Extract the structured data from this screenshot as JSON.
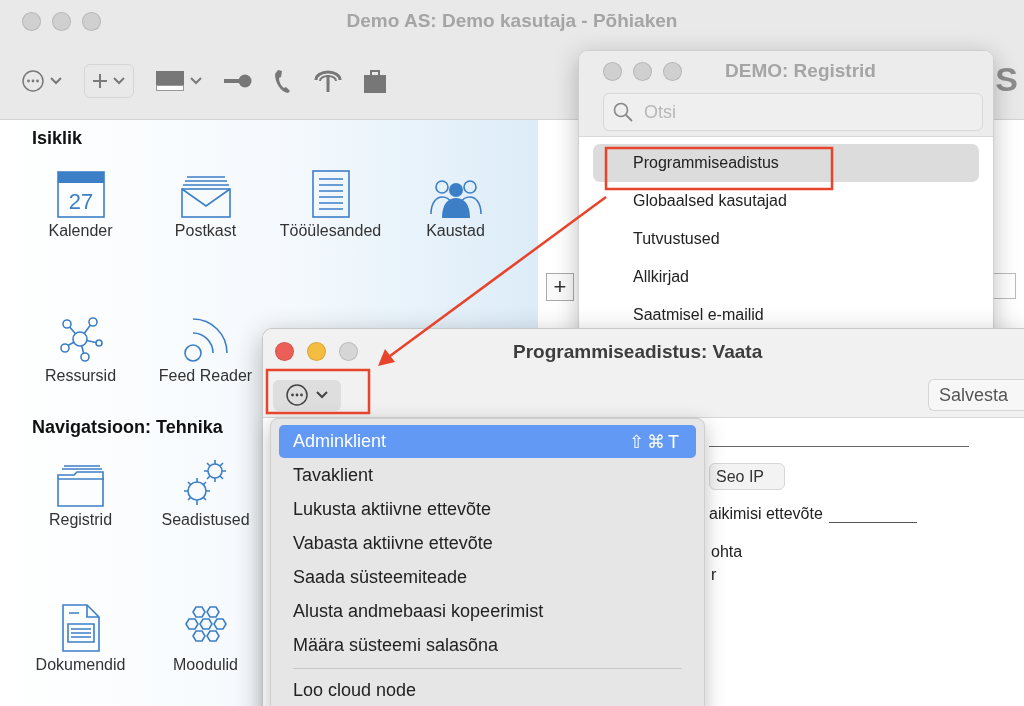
{
  "main_window": {
    "title": "Demo AS: Demo kasutaja - Põhiaken",
    "toolbar": [
      {
        "kind": "more"
      },
      {
        "kind": "add"
      },
      {
        "kind": "color"
      },
      {
        "kind": "key"
      },
      {
        "kind": "phone"
      },
      {
        "kind": "antenna"
      },
      {
        "kind": "bag"
      }
    ],
    "logo_fragment": "S",
    "sections": [
      {
        "heading": "Isiklik",
        "items": [
          {
            "label": "Kalender",
            "kind": "calendar",
            "date": "27"
          },
          {
            "label": "Postkast",
            "kind": "mail"
          },
          {
            "label": "Tööülesanded",
            "kind": "list"
          },
          {
            "label": "Kaustad",
            "kind": "people"
          },
          {
            "label": "Ressursid",
            "kind": "network"
          },
          {
            "label": "Feed Reader",
            "kind": "feed"
          }
        ]
      },
      {
        "heading": "Navigatsioon: Tehnika",
        "items": [
          {
            "label": "Registrid",
            "kind": "folder"
          },
          {
            "label": "Seadistused",
            "kind": "gears"
          },
          {
            "label": "Dokumendid",
            "kind": "document"
          },
          {
            "label": "Moodulid",
            "kind": "hexagons"
          }
        ]
      }
    ],
    "add_button": "+"
  },
  "registers_window": {
    "title": "DEMO: Registrid",
    "search": {
      "placeholder": "Otsi"
    },
    "items": [
      {
        "label": "Programmiseadistus",
        "selected": true
      },
      {
        "label": "Globaalsed kasutajad",
        "selected": false
      },
      {
        "label": "Tutvustused",
        "selected": false
      },
      {
        "label": "Allkirjad",
        "selected": false
      },
      {
        "label": "Saatmisel e-mailid",
        "selected": false
      }
    ]
  },
  "detail_window": {
    "title": "Programmiseadistus: Vaata",
    "save_button": "Salvesta",
    "ip_button": "Seo IP",
    "field_label": "aikimisi ettevõte",
    "text_fragments": [
      "ohta",
      "r"
    ]
  },
  "menu": {
    "items": [
      {
        "kind": "item",
        "label": "Adminklient",
        "shortcut": "⇧⌘T",
        "selected": true
      },
      {
        "kind": "item",
        "label": "Tavaklient",
        "selected": false
      },
      {
        "kind": "item",
        "label": "Lukusta aktiivne ettevõte",
        "selected": false
      },
      {
        "kind": "item",
        "label": "Vabasta aktiivne ettevõte",
        "selected": false
      },
      {
        "kind": "item",
        "label": "Saada süsteemiteade",
        "selected": false
      },
      {
        "kind": "item",
        "label": "Alusta andmebaasi kopeerimist",
        "selected": false
      },
      {
        "kind": "item",
        "label": "Määra süsteemi salasõna",
        "selected": false
      },
      {
        "kind": "separator"
      },
      {
        "kind": "item",
        "label": "Loo cloud node",
        "selected": false
      }
    ]
  }
}
